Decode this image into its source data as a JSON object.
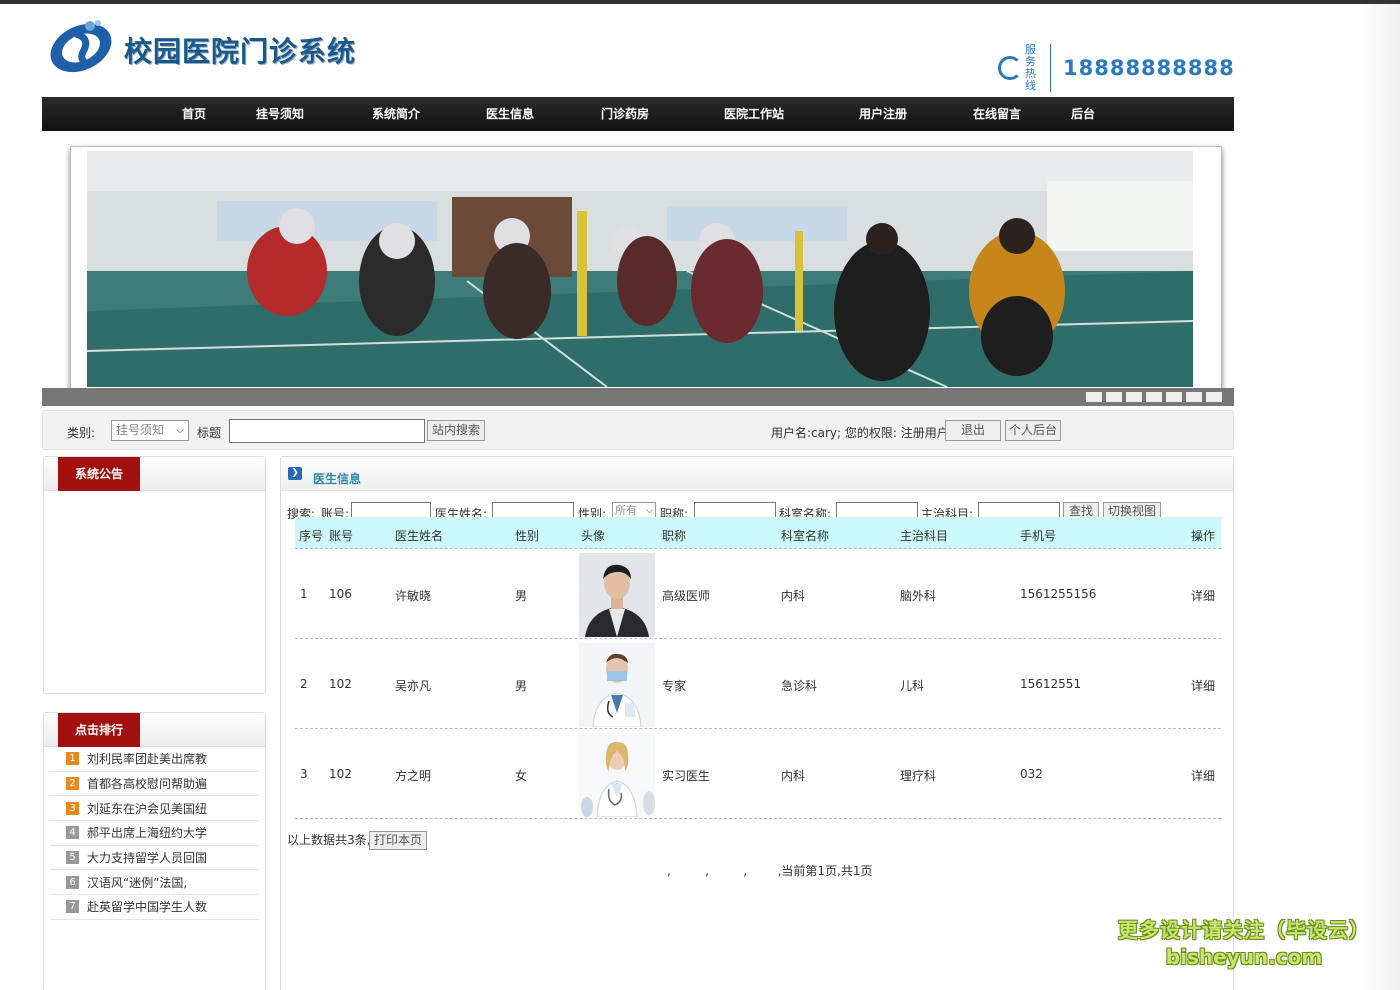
{
  "header": {
    "title": "校园医院门诊系统",
    "hotline_tag": "服务热线",
    "hotline_number": "18888888888"
  },
  "nav": {
    "items": [
      "首页",
      "挂号须知",
      "系统简介",
      "医生信息",
      "门诊药房",
      "医院工作站",
      "用户注册",
      "在线留言",
      "后台"
    ]
  },
  "search": {
    "category_label": "类别:",
    "category_value": "挂号须知",
    "title_label": "标题",
    "title_value": "",
    "search_button": "站内搜索",
    "user_info": "用户名:cary;  您的权限: 注册用户",
    "logout_button": "退出",
    "admin_button": "个人后台"
  },
  "sidebar": {
    "notice_title": "系统公告",
    "rank_title": "点击排行",
    "rank_items": [
      {
        "num": "1",
        "text": "刘利民率团赴美出席教"
      },
      {
        "num": "2",
        "text": "首都各高校慰问帮助遍"
      },
      {
        "num": "3",
        "text": "刘延东在沪会见美国纽"
      },
      {
        "num": "4",
        "text": "郝平出席上海纽约大学"
      },
      {
        "num": "5",
        "text": "大力支持留学人员回国"
      },
      {
        "num": "6",
        "text": "汉语风“迷例”法国,"
      },
      {
        "num": "7",
        "text": "赴英留学中国学生人数"
      }
    ]
  },
  "main": {
    "title": "医生信息",
    "filters": {
      "prefix": "搜索:",
      "account_label": "账号:",
      "name_label": "医生姓名:",
      "gender_label": "性别:",
      "gender_value": "所有",
      "title_label": "职称:",
      "dept_label": "科室名称:",
      "subject_label": "主治科目:",
      "find_button": "查找",
      "switch_button": "切换视图"
    },
    "columns": [
      "序号",
      "账号",
      "医生姓名",
      "性别",
      "头像",
      "职称",
      "科室名称",
      "主治科目",
      "手机号",
      "操作"
    ],
    "rows": [
      {
        "no": "1",
        "account": "106",
        "name": "许敏晓",
        "gender": "男",
        "title": "高级医师",
        "dept": "内科",
        "subject": "脑外科",
        "phone": "1561255156",
        "action": "详细"
      },
      {
        "no": "2",
        "account": "102",
        "name": "吴亦凡",
        "gender": "男",
        "title": "专家",
        "dept": "急诊科",
        "subject": "儿科",
        "phone": "15612551",
        "action": "详细"
      },
      {
        "no": "3",
        "account": "102",
        "name": "方之明",
        "gender": "女",
        "title": "实习医生",
        "dept": "内科",
        "subject": "理疗科",
        "phone": "032",
        "action": "详细"
      }
    ],
    "summary": "以上数据共3条,",
    "print_button": "打印本页",
    "pager": ",         ,         ,        ,当前第1页,共1页"
  },
  "watermark": {
    "line1": "更多设计请关注（毕设云）",
    "line2": "bisheyun.com"
  }
}
